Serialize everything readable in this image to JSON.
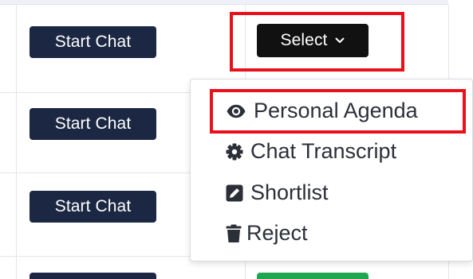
{
  "table": {
    "rows": [
      {
        "start_chat_label": "Start Chat"
      },
      {
        "start_chat_label": "Start Chat"
      },
      {
        "start_chat_label": "Start Chat"
      }
    ]
  },
  "select_menu": {
    "button_label": "Select",
    "button_icon": "chevron-down-icon",
    "items": [
      {
        "label": "Personal Agenda",
        "icon": "eye-icon"
      },
      {
        "label": "Chat Transcript",
        "icon": "gear-icon"
      },
      {
        "label": "Shortlist",
        "icon": "edit-icon"
      },
      {
        "label": "Reject",
        "icon": "trash-icon"
      }
    ]
  },
  "colors": {
    "button_dark": "#1c2743",
    "select_button": "#111111",
    "highlight": "#e8101a",
    "accept_green": "#21a650"
  }
}
